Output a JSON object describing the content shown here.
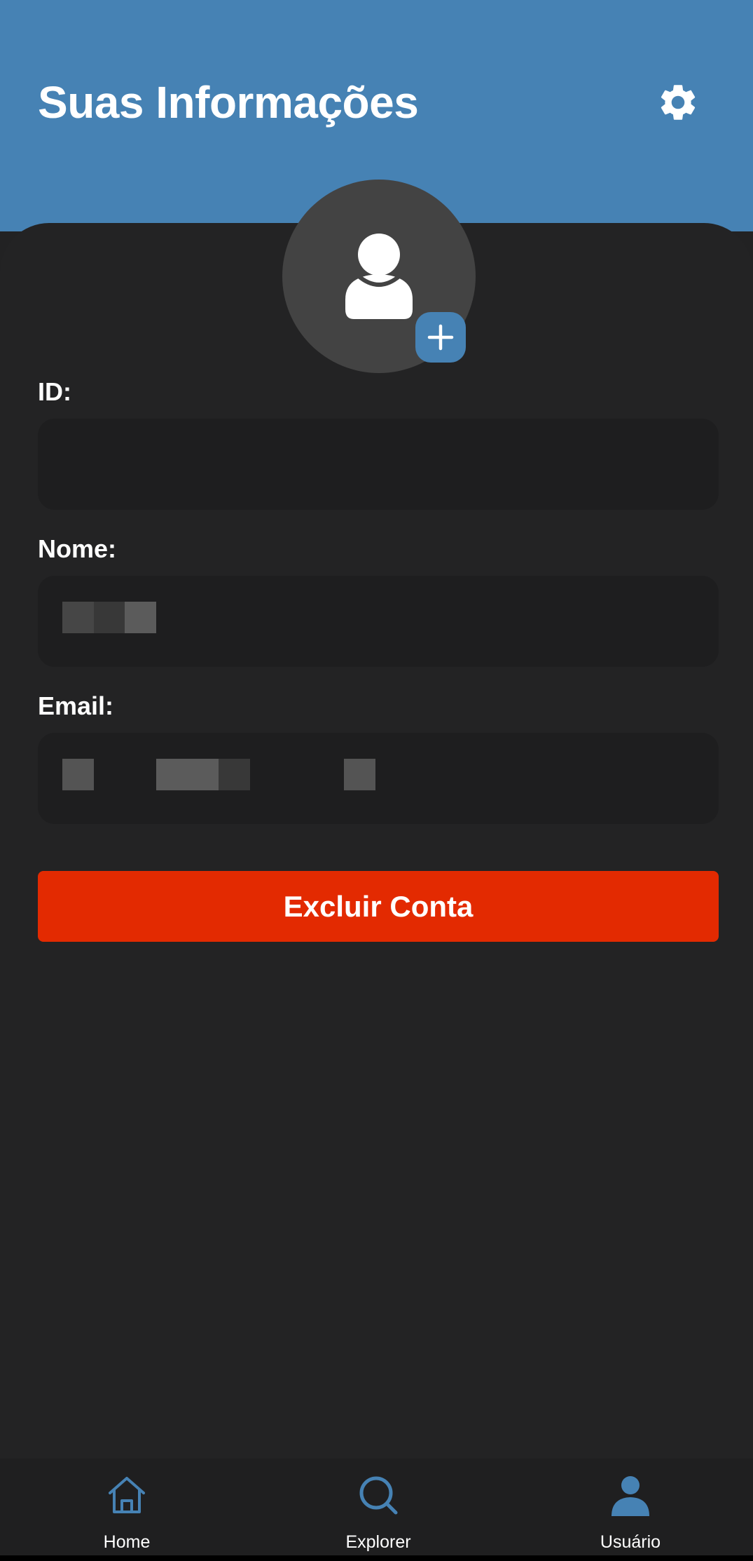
{
  "header": {
    "title": "Suas Informações",
    "settings_icon": "gear-icon",
    "background_color": "#4682b4"
  },
  "profile": {
    "avatar_icon": "user-icon",
    "add_photo_icon": "plus-icon"
  },
  "fields": [
    {
      "label": "ID:",
      "value": ""
    },
    {
      "label": "Nome:",
      "value": ""
    },
    {
      "label": "Email:",
      "value": ""
    }
  ],
  "actions": {
    "delete_account_label": "Excluir Conta",
    "delete_color": "#e32a01"
  },
  "bottom_nav": {
    "active_color": "#4682b4",
    "items": [
      {
        "label": "Home",
        "icon": "home-icon"
      },
      {
        "label": "Explorer",
        "icon": "search-icon"
      },
      {
        "label": "Usuário",
        "icon": "user-icon"
      }
    ]
  }
}
